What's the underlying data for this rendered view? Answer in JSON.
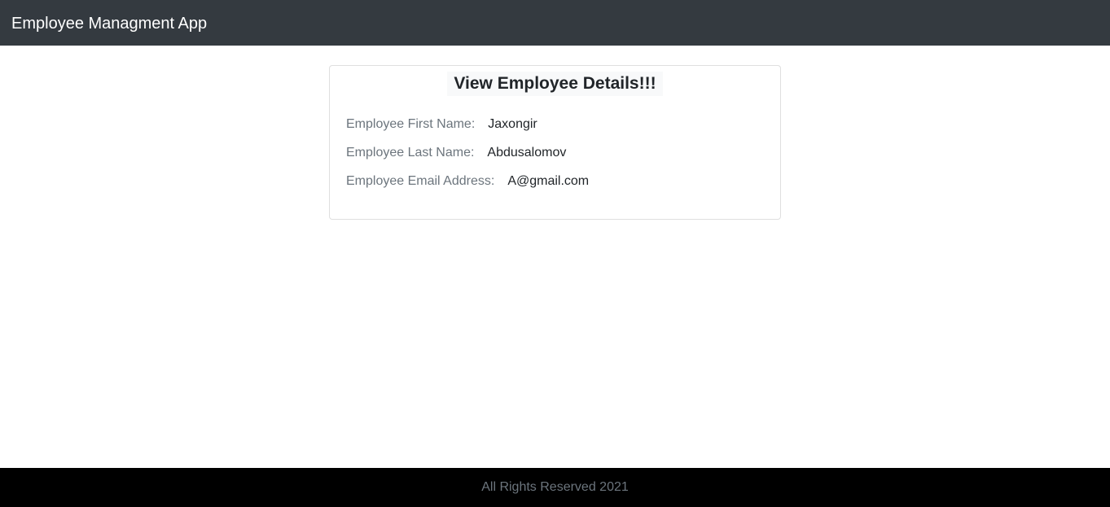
{
  "navbar": {
    "brand": "Employee Managment App",
    "background_color": "#343a40"
  },
  "card": {
    "title": "View Employee Details!!!",
    "fields": [
      {
        "label": "Employee First Name:",
        "value": "Jaxongir"
      },
      {
        "label": "Employee Last Name:",
        "value": "Abdusalomov"
      },
      {
        "label": "Employee Email Address:",
        "value": "A@gmail.com"
      }
    ]
  },
  "footer": {
    "text": "All Rights Reserved 2021",
    "background_color": "#000000"
  }
}
